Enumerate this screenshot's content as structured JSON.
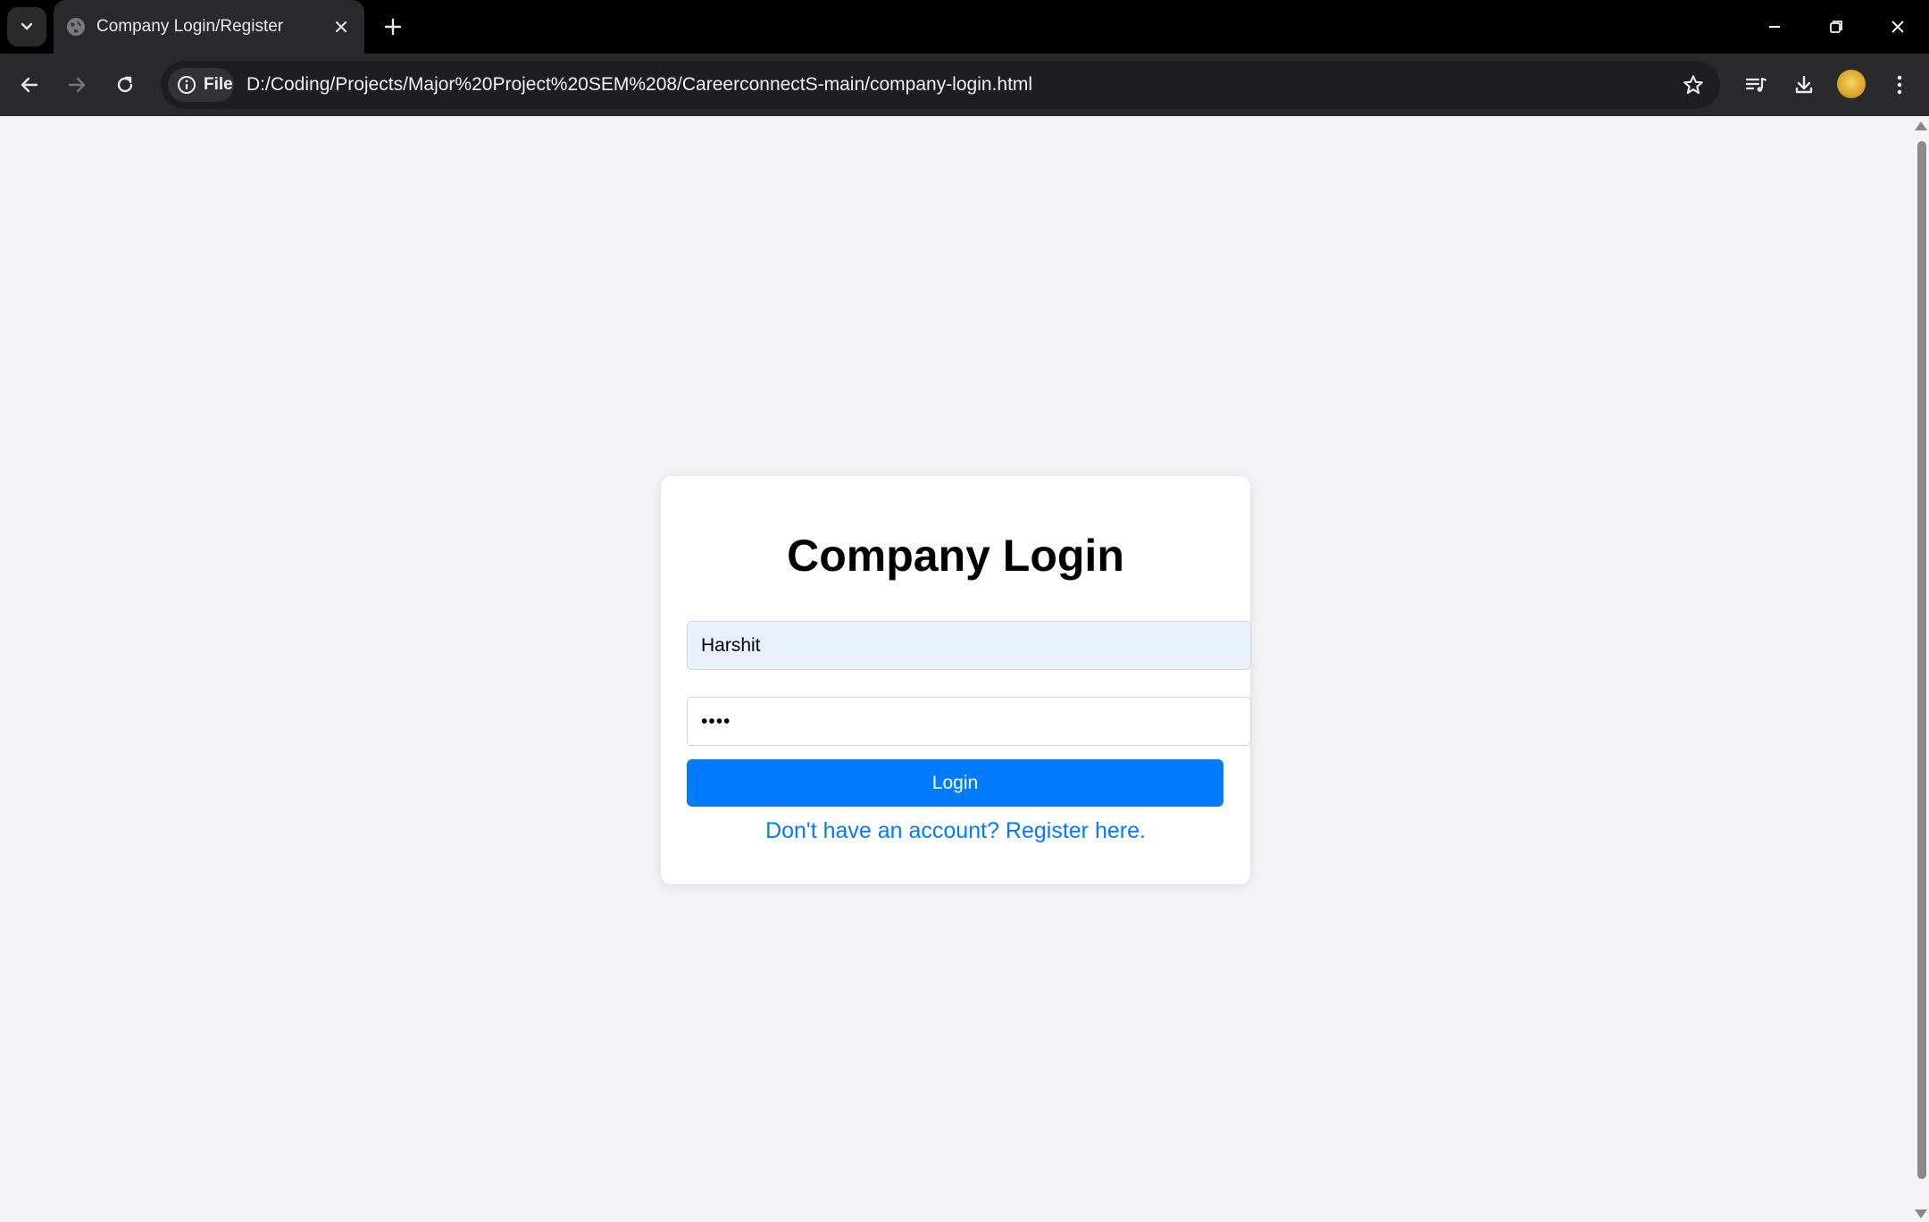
{
  "browser": {
    "tab": {
      "title": "Company Login/Register"
    },
    "omnibox": {
      "chip_label": "File",
      "url": "D:/Coding/Projects/Major%20Project%20SEM%208/CareerconnectS-main/company-login.html"
    },
    "icons": {
      "tab_search": "chevron-down-icon",
      "favicon": "globe-icon",
      "tab_close": "close-icon",
      "new_tab": "plus-icon",
      "minimize": "minimize-icon",
      "restore": "restore-icon",
      "close_window": "close-icon",
      "back": "back-arrow-icon",
      "forward": "forward-arrow-icon",
      "reload": "reload-icon",
      "site_info": "info-icon",
      "bookmark": "star-icon",
      "media": "media-queue-icon",
      "downloads": "download-icon",
      "profile": "avatar",
      "menu": "kebab-menu-icon"
    }
  },
  "page": {
    "heading": "Company Login",
    "username_value": "Harshit",
    "password_value": "1234",
    "login_label": "Login",
    "register_text": "Don't have an account? Register here."
  },
  "colors": {
    "page_bg": "#f4f4f8",
    "card_bg": "#ffffff",
    "accent": "#007bff",
    "autofill_bg": "#e8f0fe"
  }
}
